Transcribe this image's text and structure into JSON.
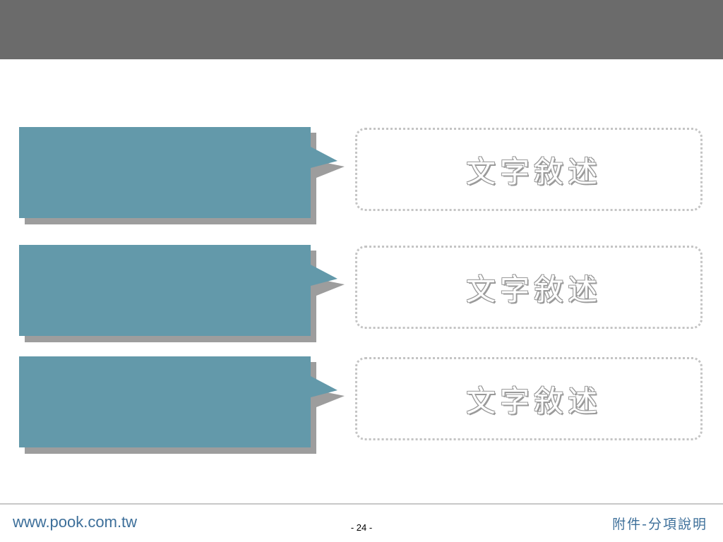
{
  "slide": {
    "items": [
      {
        "label": ""
      },
      {
        "label": ""
      },
      {
        "label": ""
      }
    ],
    "descriptions": [
      {
        "text": "文字敘述"
      },
      {
        "text": "文字敘述"
      },
      {
        "text": "文字敘述"
      }
    ]
  },
  "footer": {
    "url": "www.pook.com.tw",
    "page": "- 24 -",
    "note": "附件-分項說明"
  },
  "colors": {
    "header_bar": "#6b6b6b",
    "callout_fill": "#6399aa",
    "callout_shadow": "#9d9d9d",
    "dotted_border": "#c4c4c4",
    "footer_text": "#3d6f9a"
  }
}
